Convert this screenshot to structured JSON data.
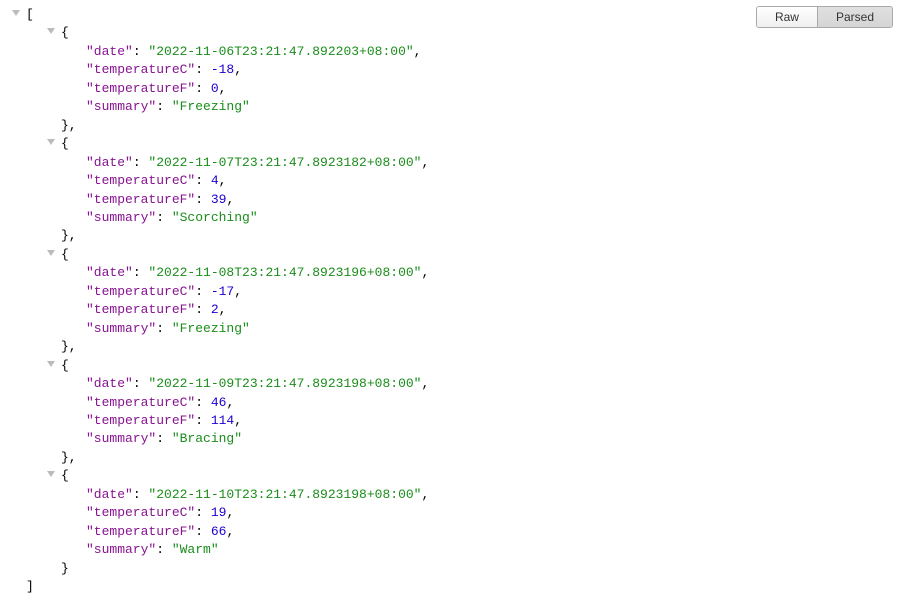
{
  "toolbar": {
    "raw_label": "Raw",
    "parsed_label": "Parsed"
  },
  "json": {
    "open_bracket": "[",
    "close_bracket": "]",
    "open_brace": "{",
    "close_brace": "}",
    "close_brace_comma": "},",
    "comma": ",",
    "colon": ": ",
    "keys": {
      "date": "\"date\"",
      "temperatureC": "\"temperatureC\"",
      "temperatureF": "\"temperatureF\"",
      "summary": "\"summary\""
    },
    "items": [
      {
        "date": "\"2022-11-06T23:21:47.892203+08:00\"",
        "temperatureC": "-18",
        "temperatureF": "0",
        "summary": "\"Freezing\""
      },
      {
        "date": "\"2022-11-07T23:21:47.8923182+08:00\"",
        "temperatureC": "4",
        "temperatureF": "39",
        "summary": "\"Scorching\""
      },
      {
        "date": "\"2022-11-08T23:21:47.8923196+08:00\"",
        "temperatureC": "-17",
        "temperatureF": "2",
        "summary": "\"Freezing\""
      },
      {
        "date": "\"2022-11-09T23:21:47.8923198+08:00\"",
        "temperatureC": "46",
        "temperatureF": "114",
        "summary": "\"Bracing\""
      },
      {
        "date": "\"2022-11-10T23:21:47.8923198+08:00\"",
        "temperatureC": "19",
        "temperatureF": "66",
        "summary": "\"Warm\""
      }
    ]
  }
}
